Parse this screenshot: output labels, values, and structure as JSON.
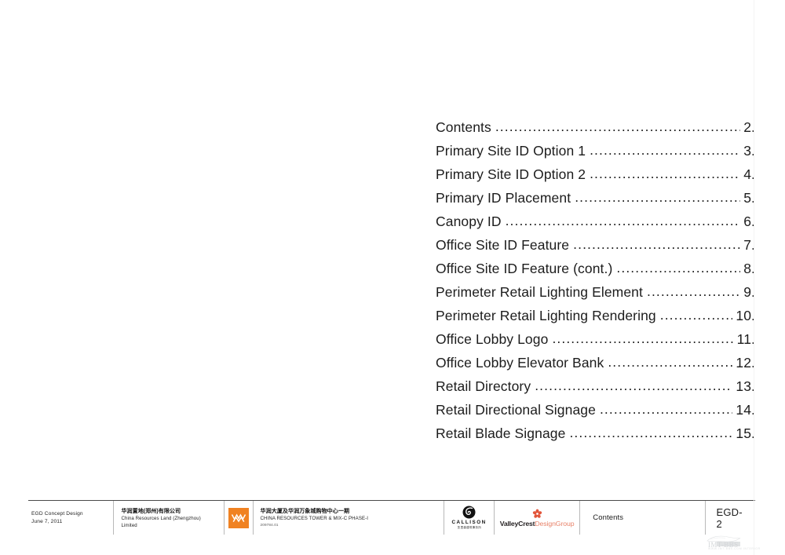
{
  "document": {
    "sheet_name": "Contents",
    "sheet_number": "EGD-2"
  },
  "toc": {
    "entries": [
      {
        "label": "Contents",
        "page": "2."
      },
      {
        "label": "Primary Site ID Option 1",
        "page": "3."
      },
      {
        "label": "Primary Site ID Option 2",
        "page": "4."
      },
      {
        "label": "Primary ID Placement",
        "page": "5."
      },
      {
        "label": "Canopy ID",
        "page": "6."
      },
      {
        "label": "Office Site ID Feature",
        "page": "7."
      },
      {
        "label": "Office Site ID Feature (cont.)",
        "page": "8."
      },
      {
        "label": "Perimeter Retail Lighting Element",
        "page": "9."
      },
      {
        "label": "Perimeter Retail Lighting Rendering",
        "page": "10."
      },
      {
        "label": "Office Lobby Logo",
        "page": "11."
      },
      {
        "label": "Office Lobby Elevator Bank",
        "page": "12."
      },
      {
        "label": "Retail Directory",
        "page": "13."
      },
      {
        "label": "Retail Directional Signage",
        "page": "14."
      },
      {
        "label": "Retail Blade Signage",
        "page": "15."
      }
    ],
    "leader_dots": "................................................................................................................"
  },
  "footer": {
    "title_line1": "EGD Concept Design",
    "title_line2": "June 7, 2011",
    "client_cn": "华润置地(郑州)有限公司",
    "client_en": "China Resources Land (Zhengzhou) Limited",
    "client_logo_icon": "china-resources-mark",
    "project_cn": "华润大厦及华润万象城购物中心一期",
    "project_en": "CHINA RESOURCES TOWER & MIX-C PHASE-I",
    "project_number": "209784.01",
    "callison_word": "CALLISON",
    "callison_cn": "凯里森建筑事务所",
    "callison_logo_icon": "callison-circle-mark",
    "valleycrest_part1": "ValleyCrest",
    "valleycrest_part2": "DesignGroup",
    "valleycrest_logo_icon": "valleycrest-flower-mark",
    "sheet_name": "Contents",
    "sheet_number": "EGD-2"
  },
  "watermark": {
    "text": "IMT-BBS",
    "subtext": "WWW.IMT-BBS.COM  INTERIOR"
  },
  "colors": {
    "brand_orange": "#f08222",
    "valleycrest_salmon": "#e8836a",
    "rule": "#4a4a4a",
    "divider": "#b9b9b9",
    "text": "#1c1c1c"
  }
}
